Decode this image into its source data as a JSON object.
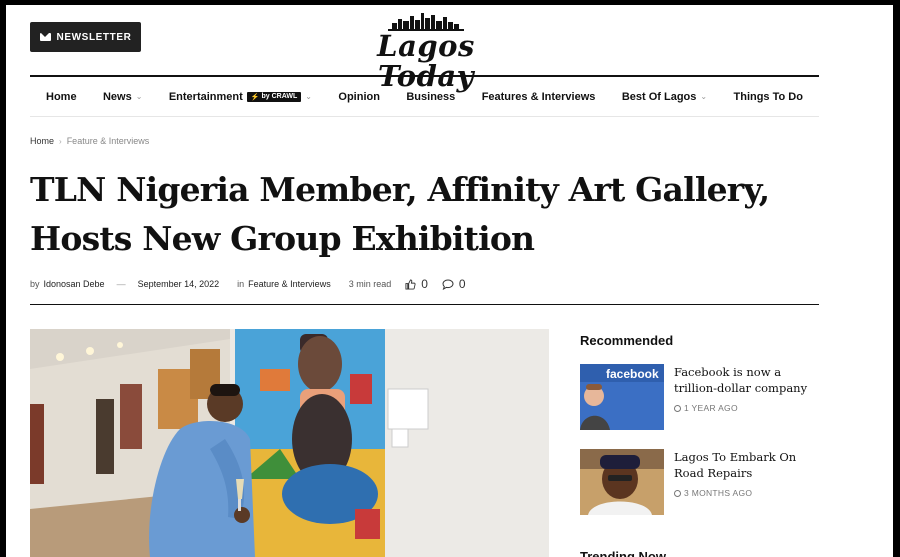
{
  "header": {
    "newsletter_label": "NEWSLETTER",
    "logo_text": "Lagos Today"
  },
  "nav": {
    "items": [
      {
        "label": "Home",
        "dropdown": false
      },
      {
        "label": "News",
        "dropdown": true
      },
      {
        "label": "Entertainment",
        "dropdown": true,
        "badge": "by CRAWL"
      },
      {
        "label": "Opinion",
        "dropdown": false
      },
      {
        "label": "Business",
        "dropdown": false
      },
      {
        "label": "Features & Interviews",
        "dropdown": false
      },
      {
        "label": "Best Of Lagos",
        "dropdown": true
      },
      {
        "label": "Things To Do",
        "dropdown": false
      }
    ]
  },
  "breadcrumb": {
    "home": "Home",
    "current": "Feature & Interviews"
  },
  "article": {
    "title": "TLN Nigeria Member, Affinity Art Gallery, Hosts New Group Exhibition",
    "by_label": "by",
    "author": "Idonosan Debe",
    "date": "September 14, 2022",
    "in_label": "in",
    "category": "Feature & Interviews",
    "read_time": "3 min read",
    "likes": "0",
    "comments": "0"
  },
  "sidebar": {
    "heading": "Recommended",
    "items": [
      {
        "title": "Facebook is now a trillion-dollar company",
        "time": "1 YEAR AGO",
        "thumb_text": "facebook"
      },
      {
        "title": "Lagos To Embark On Road Repairs",
        "time": "3 MONTHS AGO"
      }
    ],
    "next_heading": "Trending Now"
  },
  "colors": {
    "accent_dark": "#222222",
    "badge_bolt": "#f2c200",
    "facebook_blue": "#3b6fc4"
  }
}
